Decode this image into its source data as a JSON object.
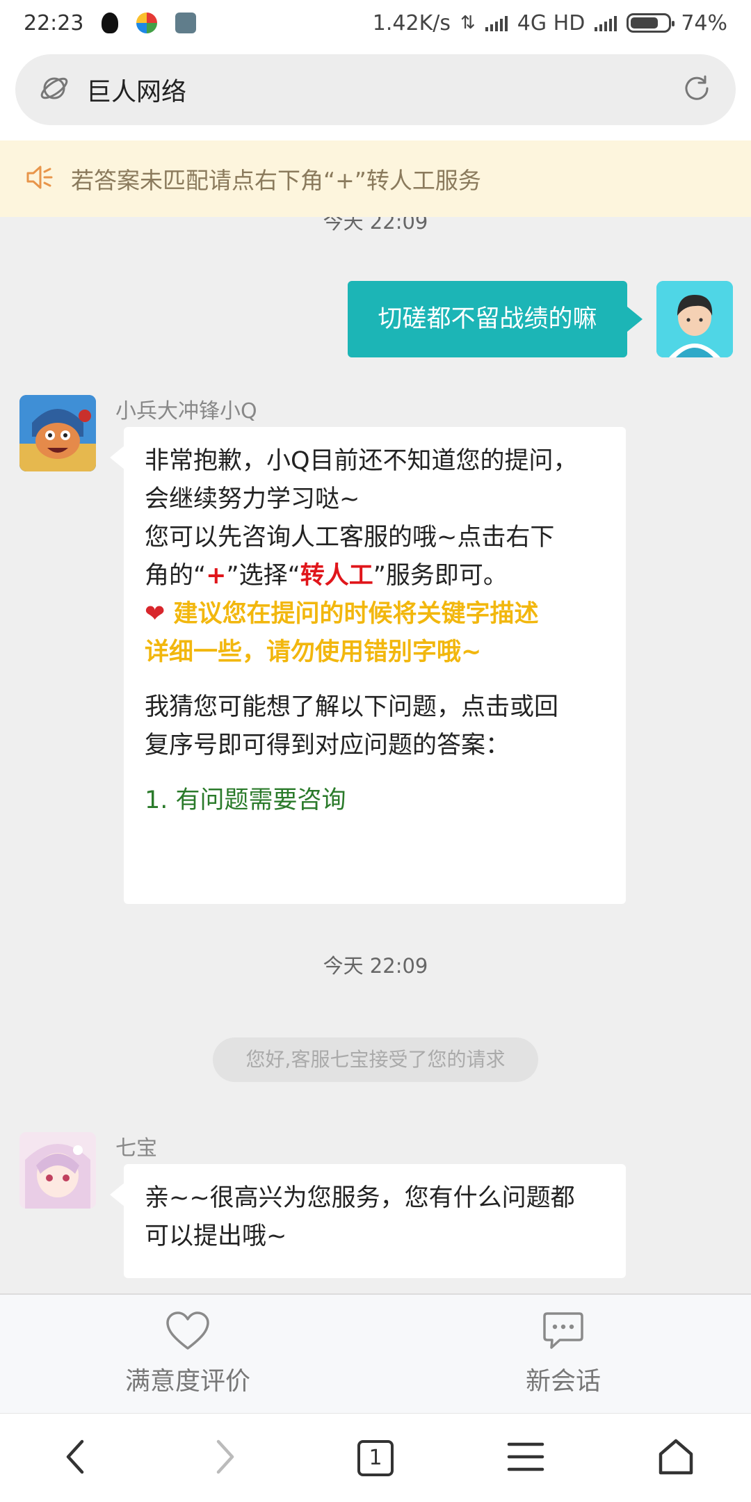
{
  "status_bar": {
    "time": "22:23",
    "speed": "1.42K/s",
    "network": "4G HD",
    "battery": "74%",
    "battery_level": 0.74
  },
  "address_bar": {
    "title": "巨人网络"
  },
  "notice": {
    "text": "若答案未匹配请点右下角“+”转人工服务"
  },
  "chat": {
    "partial_timestamp": "今天 22:09",
    "messages": [
      {
        "from": "me",
        "text": "切磋都不留战绩的嘛"
      },
      {
        "from": "bot",
        "sender_name": "小兵大冲锋小Q",
        "line1": "非常抱歉，小Q目前还不知道您的提问，",
        "line2": "会继续努力学习哒~",
        "line3": "您可以先咨询人工客服的哦~点击右下",
        "line4_a": "角的“",
        "line4_plus": "+",
        "line4_b": "”选择“",
        "line4_transfer": "转人工",
        "line4_c": "”服务即可。",
        "heart": "❤",
        "tip_line1": " 建议您在提问的时候将关键字描述",
        "tip_line2": "详细一些，请勿使用错别字哦~",
        "guess_line1": "我猜您可能想了解以下问题，点击或回",
        "guess_line2": "复序号即可得到对应问题的答案：",
        "option1": "1. 有问题需要咨询"
      }
    ],
    "timestamp2": "今天 22:09",
    "system_message": "您好,客服七宝接受了您的请求",
    "agent": {
      "sender_name": "七宝",
      "line1": "亲~~很高兴为您服务，您有什么问题都",
      "line2": "可以提出哦~"
    }
  },
  "actions": {
    "rate_label": "满意度评价",
    "new_session_label": "新会话"
  },
  "nav": {
    "tab_count": "1"
  },
  "colors": {
    "accent": "#1cb5b6",
    "transfer_red": "#e0161b",
    "tip_yellow": "#f2b70e",
    "option_green": "#2a7a2a"
  }
}
